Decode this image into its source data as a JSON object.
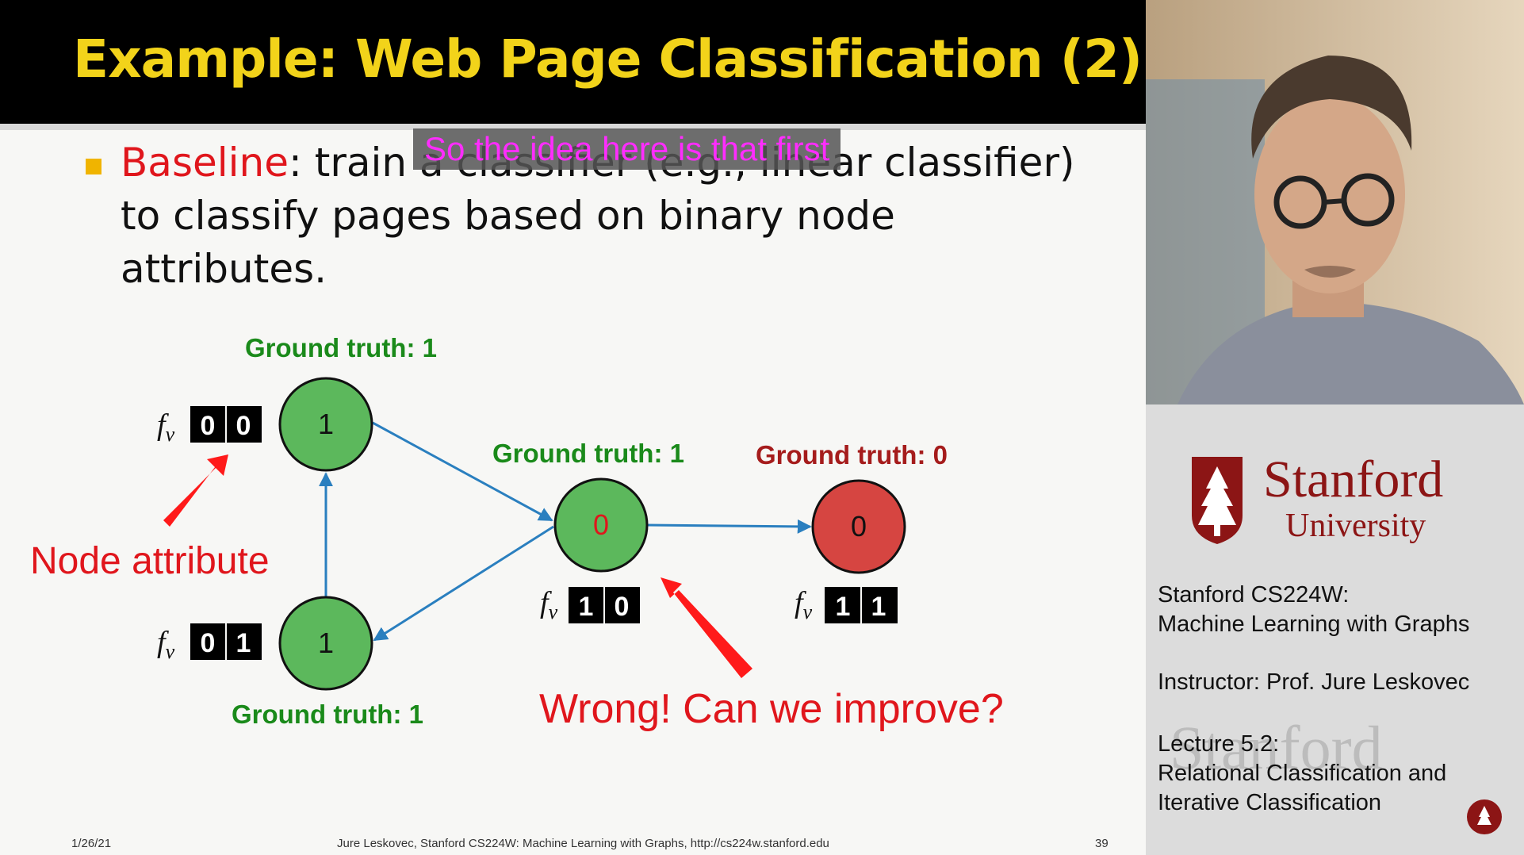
{
  "slide": {
    "title": "Example: Web Page Classification (2)",
    "bullet": {
      "keyword": "Baseline",
      "text": ": train a classifier (e.g., linear classifier) to classify pages based on binary node attributes."
    },
    "caption": "So the idea here is that first",
    "footer": {
      "date": "1/26/21",
      "center": "Jure Leskovec, Stanford CS224W: Machine Learning with Graphs, http://cs224w.stanford.edu",
      "page": "39"
    }
  },
  "diagram": {
    "feature_symbol": "f",
    "feature_subscript": "v",
    "nodes": [
      {
        "id": "top-left",
        "label": "1",
        "color": "#5cb85c",
        "label_color": "#111111",
        "ground_truth": "Ground truth: 1",
        "gt_color": "#1a8a1a",
        "bits": [
          "0",
          "0"
        ]
      },
      {
        "id": "bottom-left",
        "label": "1",
        "color": "#5cb85c",
        "label_color": "#111111",
        "ground_truth": "Ground truth: 1",
        "gt_color": "#1a8a1a",
        "bits": [
          "0",
          "1"
        ]
      },
      {
        "id": "middle",
        "label": "0",
        "color": "#5cb85c",
        "label_color": "#e0161c",
        "ground_truth": "Ground truth: 1",
        "gt_color": "#1a8a1a",
        "bits": [
          "1",
          "0"
        ]
      },
      {
        "id": "right",
        "label": "0",
        "color": "#d64541",
        "label_color": "#111111",
        "ground_truth": "Ground truth: 0",
        "gt_color": "#a51c1c",
        "bits": [
          "1",
          "1"
        ]
      }
    ],
    "annotations": {
      "node_attribute": "Node attribute",
      "wrong": "Wrong! Can we improve?"
    },
    "colors": {
      "edge": "#2a7fbf",
      "arrow": "#ff1a1a",
      "annotation_text": "#e0161c"
    }
  },
  "sidebar": {
    "logo_text": "Stanford",
    "logo_subtext": "University",
    "course": "Stanford CS224W:\nMachine Learning with Graphs",
    "instructor": "Instructor: Prof. Jure Leskovec",
    "lecture": "Lecture 5.2:\nRelational Classification and\nIterative Classification",
    "watermark": "Stanford",
    "colors": {
      "cardinal": "#8c1515"
    }
  }
}
